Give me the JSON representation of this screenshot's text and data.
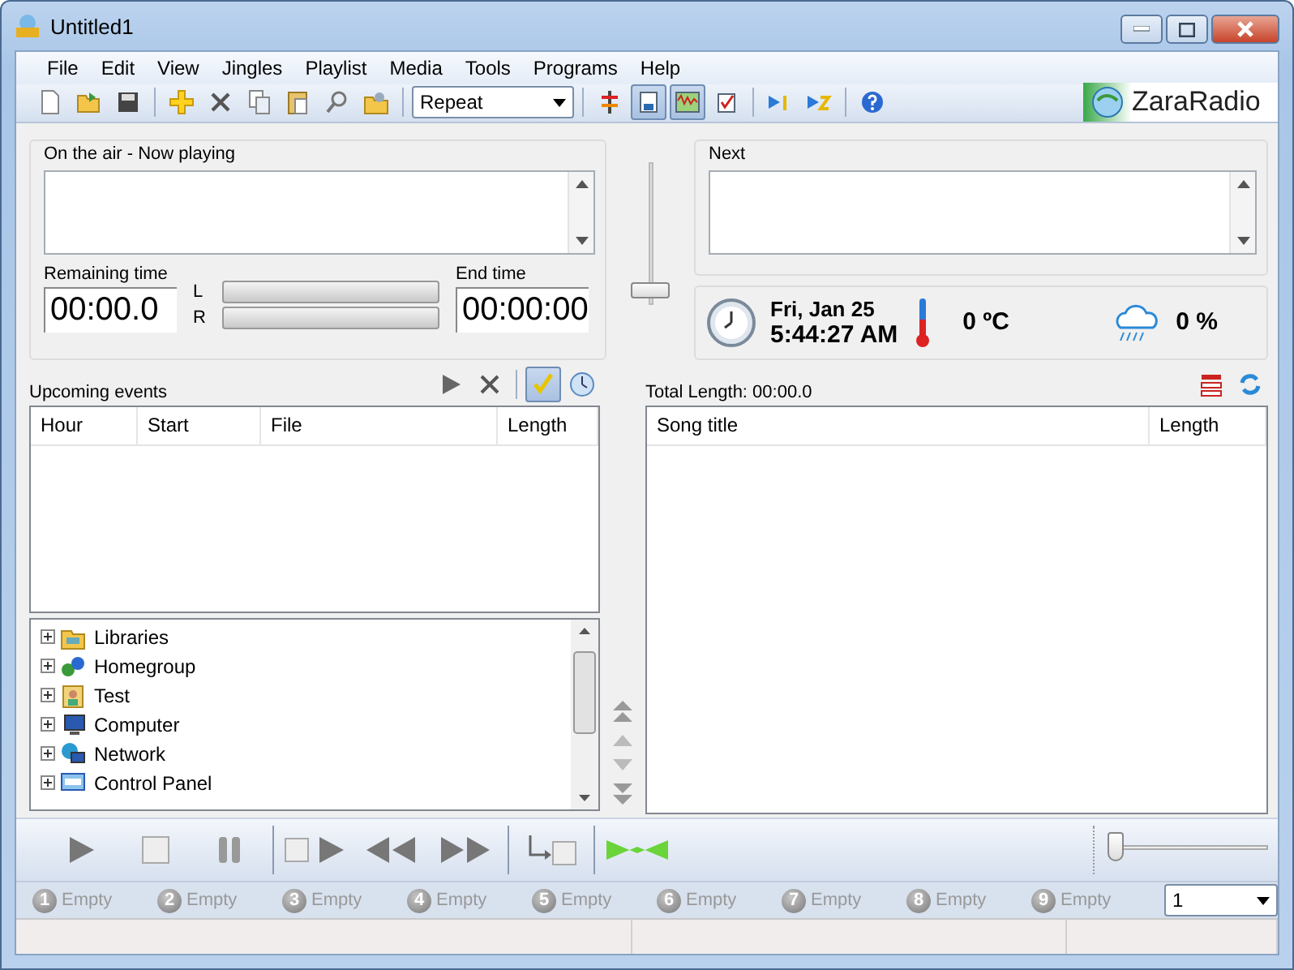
{
  "window": {
    "title": "Untitled1"
  },
  "menu": [
    "File",
    "Edit",
    "View",
    "Jingles",
    "Playlist",
    "Media",
    "Tools",
    "Programs",
    "Help"
  ],
  "toolbar": [
    {
      "kind": "button",
      "pressed": false
    },
    {
      "kind": "button",
      "pressed": false
    },
    {
      "kind": "button",
      "pressed": false
    },
    {
      "kind": "separator"
    },
    {
      "kind": "button",
      "pressed": false
    },
    {
      "kind": "button",
      "pressed": false
    },
    {
      "kind": "button",
      "pressed": false
    },
    {
      "kind": "button",
      "pressed": false
    },
    {
      "kind": "button",
      "pressed": false
    },
    {
      "kind": "button",
      "pressed": false
    },
    {
      "kind": "separator"
    },
    {
      "kind": "select",
      "value": "Repeat"
    },
    {
      "kind": "separator"
    },
    {
      "kind": "button",
      "pressed": false
    },
    {
      "kind": "button",
      "pressed": true
    },
    {
      "kind": "button",
      "pressed": true
    },
    {
      "kind": "button",
      "pressed": false
    },
    {
      "kind": "separator"
    },
    {
      "kind": "button",
      "pressed": false
    },
    {
      "kind": "button",
      "pressed": false
    },
    {
      "kind": "separator"
    },
    {
      "kind": "button",
      "pressed": false
    }
  ],
  "logo": "ZaraRadio",
  "on_air": {
    "title": "On the air - Now playing",
    "remaining_label": "Remaining time",
    "remaining": "00:00.0",
    "end_label": "End time",
    "end": "00:00:00",
    "left": "L",
    "right": "R",
    "fader": {
      "level": 0.05
    }
  },
  "next": {
    "title": "Next"
  },
  "clock": {
    "date": "Fri, Jan 25",
    "time": "5:44:27 AM",
    "temperature": "0 ºC",
    "rain": "0 %"
  },
  "events": {
    "title": "Upcoming events",
    "check_pressed": true,
    "columns": [
      "Hour",
      "Start",
      "File",
      "Length"
    ]
  },
  "tree": [
    {
      "label": "Libraries",
      "expanded": false
    },
    {
      "label": "Homegroup",
      "expanded": false
    },
    {
      "label": "Test",
      "expanded": false
    },
    {
      "label": "Computer",
      "expanded": false
    },
    {
      "label": "Network",
      "expanded": false
    },
    {
      "label": "Control Panel",
      "expanded": false
    }
  ],
  "playlist": {
    "total": "Total Length: 00:00.0",
    "columns": [
      "Song title",
      "Length"
    ]
  },
  "volume": {
    "level": 0.0
  },
  "jingles": [
    {
      "number": "1",
      "label": "Empty"
    },
    {
      "number": "2",
      "label": "Empty"
    },
    {
      "number": "3",
      "label": "Empty"
    },
    {
      "number": "4",
      "label": "Empty"
    },
    {
      "number": "5",
      "label": "Empty"
    },
    {
      "number": "6",
      "label": "Empty"
    },
    {
      "number": "7",
      "label": "Empty"
    },
    {
      "number": "8",
      "label": "Empty"
    },
    {
      "number": "9",
      "label": "Empty"
    }
  ],
  "jingle_page": {
    "value": "1"
  }
}
